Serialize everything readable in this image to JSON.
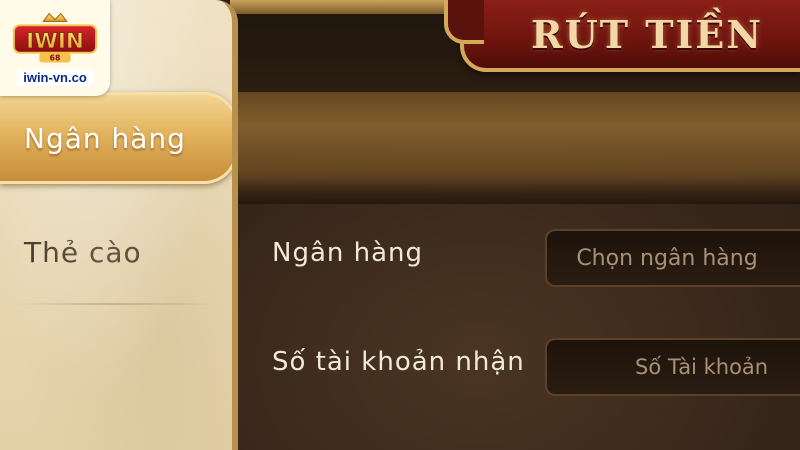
{
  "logo": {
    "brand": "iWIN",
    "domain": "iwin-vn.co"
  },
  "header": {
    "title": "RÚT TIỀN"
  },
  "sidebar": {
    "items": [
      {
        "label": "Ngân hàng",
        "active": true
      },
      {
        "label": "Thẻ cào",
        "active": false
      }
    ]
  },
  "form": {
    "bank_label": "Ngân hàng",
    "bank_placeholder": "Chọn ngân hàng",
    "account_label": "Số tài khoản nhận",
    "account_placeholder": "Số Tài khoản"
  },
  "colors": {
    "title_badge": "#6e140e",
    "active_tab": "#e2b35e",
    "sidebar": "#e8d8b4",
    "panel": "#36261a"
  }
}
